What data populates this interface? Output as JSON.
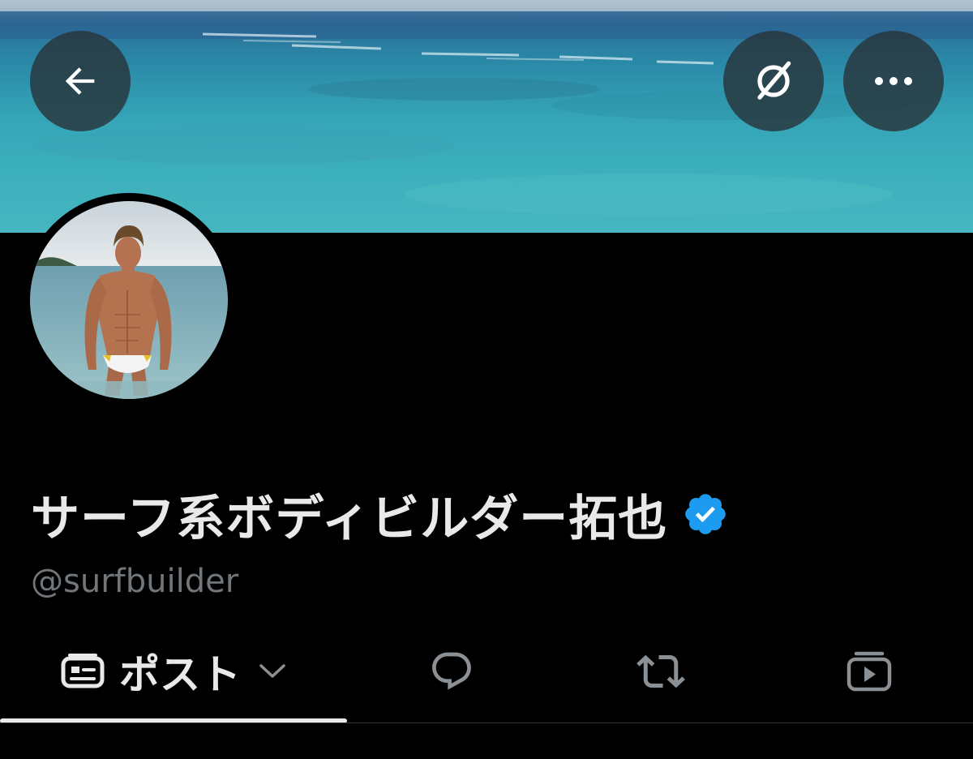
{
  "header": {
    "back_icon": "arrow-left-icon",
    "grok_icon": "grok-icon",
    "more_icon": "more-horizontal-icon"
  },
  "profile": {
    "display_name": "サーフ系ボディビルダー拓也",
    "handle": "@surfbuilder",
    "verified": true,
    "verified_color": "#1d9bf0"
  },
  "tabs": [
    {
      "label": "ポスト",
      "icon": "posts-icon",
      "active": true,
      "has_dropdown": true
    },
    {
      "label": "",
      "icon": "reply-bubble-icon",
      "active": false
    },
    {
      "label": "",
      "icon": "repost-icon",
      "active": false
    },
    {
      "label": "",
      "icon": "media-icon",
      "active": false
    }
  ],
  "colors": {
    "background": "#000000",
    "text_primary": "#e7e9ea",
    "text_secondary": "#71767b",
    "accent": "#1d9bf0"
  }
}
